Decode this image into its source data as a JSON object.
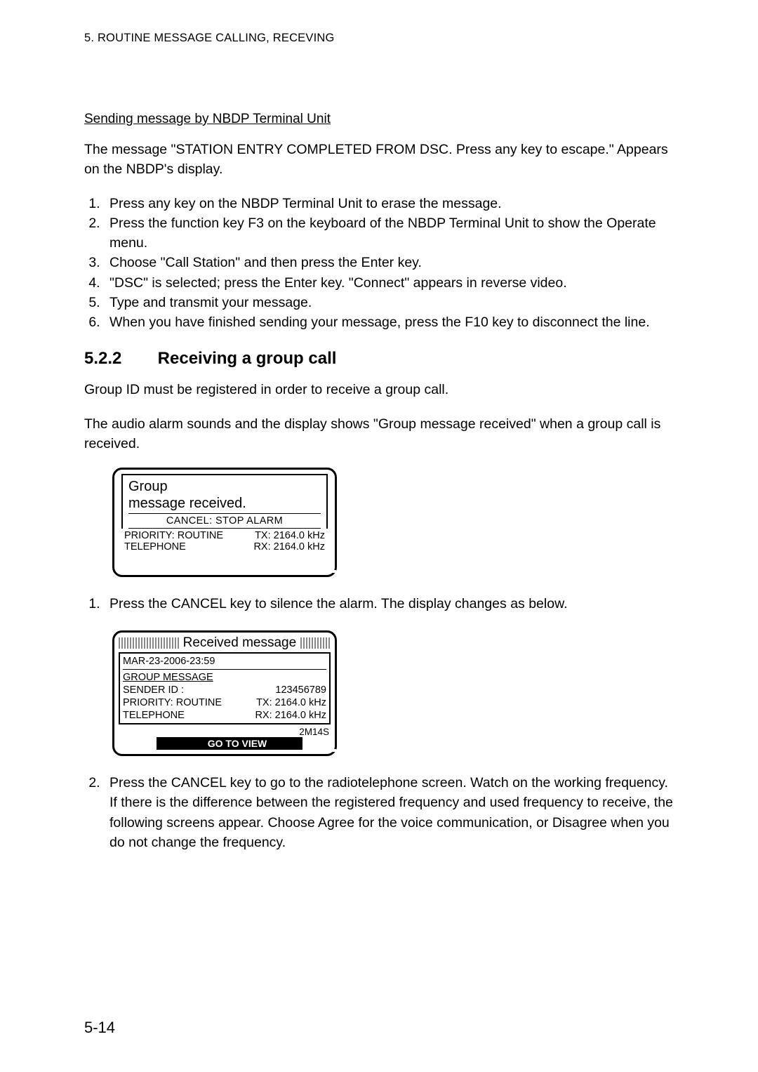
{
  "header": "5. ROUTINE MESSAGE CALLING, RECEVING",
  "subheading": "Sending message by NBDP Terminal Unit",
  "intro1": "The message \"STATION ENTRY COMPLETED FROM DSC. Press any key to escape.\" Appears on the NBDP's display.",
  "steps1": [
    "Press any key on the NBDP Terminal Unit to erase the message.",
    "Press the function key F3 on the keyboard of the NBDP Terminal Unit to show the Operate menu.",
    "Choose \"Call Station\" and then press the Enter key.",
    "\"DSC\" is selected; press the Enter key. \"Connect\" appears in reverse video.",
    "Type and transmit your message.",
    "When you have finished sending your message, press the F10 key to disconnect the line."
  ],
  "section": {
    "num": "5.2.2",
    "title": "Receiving a group call"
  },
  "para1": "Group ID must be registered in order to receive a group call.",
  "para2": "The audio alarm sounds and the display shows \"Group message received\" when a group call is received.",
  "display1": {
    "l1": "Group",
    "l2": "message received.",
    "sub": "CANCEL: STOP ALARM",
    "p1a": "PRIORITY:  ROUTINE",
    "p1b": "TX: 2164.0 kHz",
    "p2a": "TELEPHONE",
    "p2b": "RX: 2164.0 kHz"
  },
  "step2_1": "Press the CANCEL key to silence the alarm. The display changes as below.",
  "display2": {
    "bar": "Received message",
    "date": "MAR-23-2006-23:59",
    "grp": "GROUP MESSAGE",
    "sida": "SENDER ID :",
    "sidb": "123456789",
    "pra": "PRIORITY:  ROUTINE",
    "prb": "TX: 2164.0 kHz",
    "tla": "TELEPHONE",
    "tlb": "RX: 2164.0 kHz",
    "time": "2M14S",
    "goto": "GO TO VIEW"
  },
  "step2_2": "Press the CANCEL key to go to the radiotelephone screen. Watch on the working frequency. If there is the difference between the registered frequency and used frequency to receive, the following screens appear. Choose Agree for the voice communication, or Disagree when you do not change the frequency.",
  "pagenum": "5-14"
}
